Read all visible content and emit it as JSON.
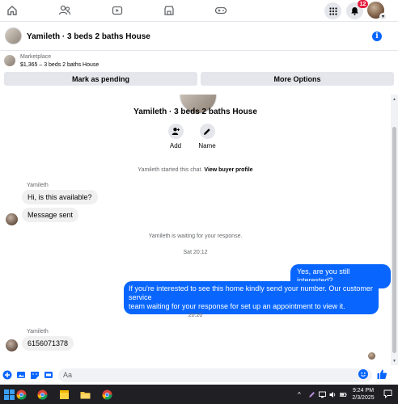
{
  "notifications": {
    "count": "12"
  },
  "chat_header": {
    "title": "Yamileth · 3 beds 2 baths House"
  },
  "marketplace": {
    "label": "Marketplace",
    "listing": "$1,365 – 3 beds 2 baths House",
    "mark_pending_label": "Mark as pending",
    "more_options_label": "More Options"
  },
  "profile": {
    "name": "Yamileth · 3 beds 2 baths House",
    "add_label": "Add",
    "name_label": "Name"
  },
  "conversation": {
    "started_text": "Yamileth started this chat.",
    "view_buyer_profile": "View buyer profile",
    "sender_name_1": "Yamileth",
    "msg_in_1": "Hi, is this available?",
    "msg_in_2": "Message sent",
    "waiting_text": "Yamileth is waiting for your response.",
    "timestamp_1": "Sat 20:12",
    "msg_out_1": "Yes, are you still interested?",
    "msg_out_2_line1": "If you're interested to see this home kindly send your number. Our customer service",
    "msg_out_2_line2": "team waiting for your response for set up an appointment to view it.",
    "timestamp_2": "20:20",
    "sender_name_2": "Yamileth",
    "msg_in_3": "6156071378"
  },
  "composer": {
    "placeholder": "Aa"
  },
  "taskbar": {
    "time": "9:24 PM",
    "date": "2/3/2025"
  },
  "colors": {
    "accent": "#0866ff",
    "badge": "#e41e3f",
    "bubble_in": "#f0f0f0"
  }
}
